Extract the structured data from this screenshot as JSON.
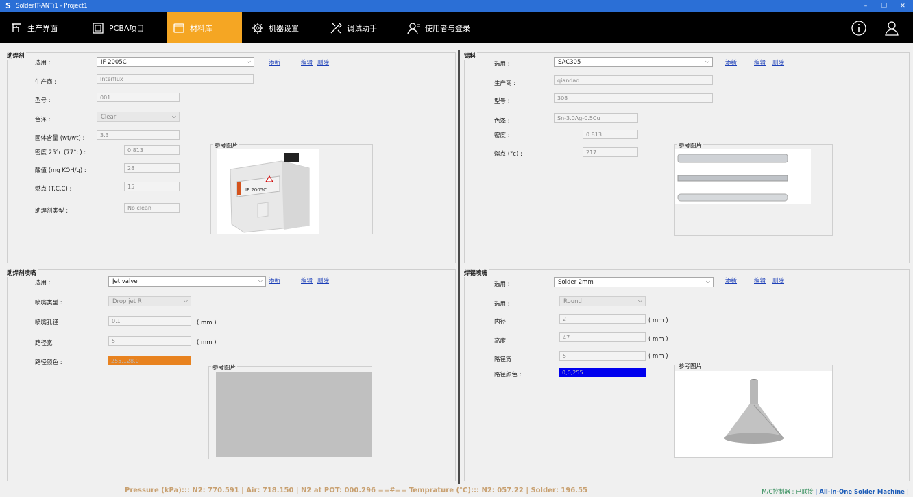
{
  "window": {
    "title": "SolderIT-ANTi1 - Project1"
  },
  "window_controls": {
    "minimize": "–",
    "restore": "❐",
    "close": "✕"
  },
  "menu": {
    "items": [
      {
        "label": "生产界面",
        "icon": "production-icon"
      },
      {
        "label": "PCBA项目",
        "icon": "pcba-icon"
      },
      {
        "label": "材料库",
        "icon": "material-library-icon",
        "active": true
      },
      {
        "label": "机器设置",
        "icon": "gear-icon"
      },
      {
        "label": "调试助手",
        "icon": "tools-icon"
      },
      {
        "label": "使用者与登录",
        "icon": "user-login-icon"
      }
    ],
    "right_icons": [
      "info-icon",
      "user-icon"
    ]
  },
  "flux": {
    "title": "助焊剂",
    "select_label": "选用 :",
    "select_value": "IF 2005C",
    "add": "添新",
    "edit": "编辑",
    "delete": "删除",
    "manufacturer_label": "生产商 :",
    "manufacturer_value": "Interflux",
    "model_label": "型号 :",
    "model_value": "001",
    "color_label": "色泽 :",
    "color_value": "Clear",
    "solid_label": "固体含量 (wt/wt) :",
    "solid_value": "3.3",
    "density_label": "密度 25°c (77°c) :",
    "density_value": "0.813",
    "acid_label": "酸值 (mg KOH/g) :",
    "acid_value": "28",
    "flash_label": "燃点 (T.C.C) :",
    "flash_value": "15",
    "type_label": "助焊剂类型 :",
    "type_value": "No clean",
    "ref_title": "参考图片",
    "product_label_text": "IF 2005C"
  },
  "solder": {
    "title": "锡料",
    "select_label": "选用 :",
    "select_value": "SAC305",
    "add": "添新",
    "edit": "编辑",
    "delete": "删除",
    "manufacturer_label": "生产商 :",
    "manufacturer_value": "qiandao",
    "model_label": "型号 :",
    "model_value": "308",
    "color_label": "色泽 :",
    "color_value": "Sn-3.0Ag-0.5Cu",
    "density_label": "密度 :",
    "density_value": "0.813",
    "melt_label": "熔点 (°c) :",
    "melt_value": "217",
    "ref_title": "参考图片"
  },
  "flux_nozzle": {
    "title": "助焊剂喷嘴",
    "select_label": "选用 :",
    "select_value": "Jet valve",
    "add": "添新",
    "edit": "编辑",
    "delete": "删除",
    "nozzle_type_label": "喷嘴类型 :",
    "nozzle_type_value": "Drop jet R",
    "hole_label": "喷嘴孔径",
    "hole_value": "0.1",
    "path_width_label": "路径宽",
    "path_width_value": "5",
    "unit": "( mm )",
    "path_color_label": "路径颜色 :",
    "path_color_value": "255,128,0",
    "path_color_hex": "#e8821f",
    "ref_title": "参考图片"
  },
  "solder_nozzle": {
    "title": "焊锡喷嘴",
    "select_label": "选用 :",
    "select_value": "Solder 2mm",
    "add": "添新",
    "edit": "编辑",
    "delete": "删除",
    "shape_label": "选用 :",
    "shape_value": "Round",
    "inner_label": "内径",
    "inner_value": "2",
    "height_label": "高度",
    "height_value": "47",
    "path_width_label": "路径宽",
    "path_width_value": "5",
    "unit": "( mm )",
    "path_color_label": "路径颜色 :",
    "path_color_value": "0,0,255",
    "path_color_hex": "#0000ee",
    "ref_title": "参考图片"
  },
  "status": {
    "main": "Pressure (kPa)::: N2: 770.591 | Air: 718.150  | N2 at POT: 000.296 ==#== Temprature (°C)::: N2: 057.22 | Solder: 196.55",
    "controller": "M/C控制器 : 已联接",
    "machine": "| All-In-One Solder Machine |"
  }
}
